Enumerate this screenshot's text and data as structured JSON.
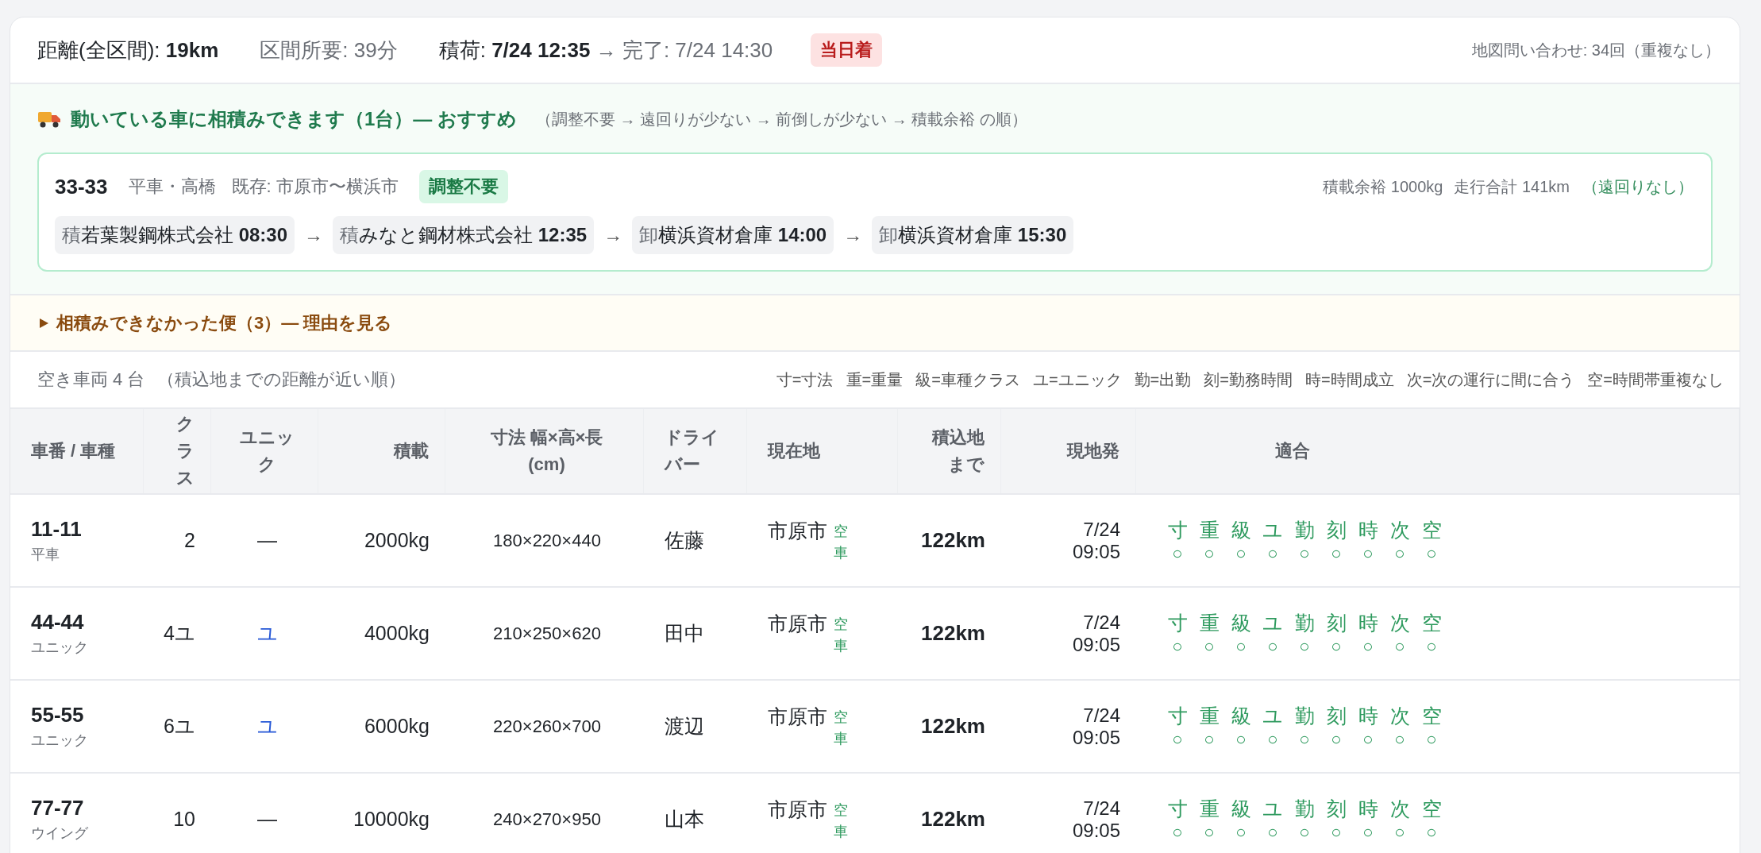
{
  "summary": {
    "distance_label": "距離(全区間):",
    "distance_value": "19km",
    "duration": "区間所要: 39分",
    "loading_label": "積荷:",
    "loading_value": "7/24 12:35",
    "arrow": "→",
    "completion": "完了: 7/24 14:30",
    "badge": "当日着",
    "map_queries": "地図問い合わせ: 34回（重複なし）"
  },
  "recommendation": {
    "title": "動いている車に相積みできます（1台）— おすすめ",
    "note": "（調整不要 → 遠回りが少ない → 前倒しが少ない → 積載余裕 の順）",
    "card": {
      "vehicle": "33-33",
      "type": "平車・高橋",
      "existing": "既存: 市原市〜横浜市",
      "badge": "調整不要",
      "capacity": "積載余裕 1000kg",
      "total": "走行合計 141km",
      "detour": "（遠回りなし）",
      "arrow": "→",
      "stops": [
        {
          "type": "積",
          "place": "若葉製鋼株式会社",
          "time": "08:30"
        },
        {
          "type": "積",
          "place": "みなと鋼材株式会社",
          "time": "12:35"
        },
        {
          "type": "卸",
          "place": "横浜資材倉庫",
          "time": "14:00"
        },
        {
          "type": "卸",
          "place": "横浜資材倉庫",
          "time": "15:30"
        }
      ]
    }
  },
  "rejected": {
    "label": "相積みできなかった便（3）— 理由を見る",
    "expanded": false
  },
  "vehicles": {
    "count": "空き車両 4 台",
    "sort_note": "（積込地までの距離が近い順）",
    "legend": [
      "寸=寸法",
      "重=重量",
      "級=車種クラス",
      "ユ=ユニック",
      "勤=出勤",
      "刻=勤務時間",
      "時=時間成立",
      "次=次の運行に間に合う",
      "空=時間帯重複なし"
    ]
  },
  "table": {
    "columns": [
      "車番 / 車種",
      "クラス",
      "ユニック",
      "積載",
      "寸法 幅×高×長 (cm)",
      "ドライバー",
      "現在地",
      "積込地まで",
      "現地発",
      "適合"
    ],
    "rows": [
      {
        "number": "11-11",
        "type": "平車",
        "class": "2",
        "unic": "—",
        "unic_available": false,
        "load": "2000kg",
        "size": "180×220×440",
        "driver": "佐藤",
        "location": "市原市",
        "status": "空車",
        "distance": "122km",
        "date": "7/24",
        "time": "09:05",
        "fit": [
          {
            "label": "寸",
            "mark": "○"
          },
          {
            "label": "重",
            "mark": "○"
          },
          {
            "label": "級",
            "mark": "○"
          },
          {
            "label": "ユ",
            "mark": "○"
          },
          {
            "label": "勤",
            "mark": "○"
          },
          {
            "label": "刻",
            "mark": "○"
          },
          {
            "label": "時",
            "mark": "○"
          },
          {
            "label": "次",
            "mark": "○"
          },
          {
            "label": "空",
            "mark": "○"
          }
        ]
      },
      {
        "number": "44-44",
        "type": "ユニック",
        "class": "4ユ",
        "unic": "ユ",
        "unic_available": true,
        "load": "4000kg",
        "size": "210×250×620",
        "driver": "田中",
        "location": "市原市",
        "status": "空車",
        "distance": "122km",
        "date": "7/24",
        "time": "09:05",
        "fit": [
          {
            "label": "寸",
            "mark": "○"
          },
          {
            "label": "重",
            "mark": "○"
          },
          {
            "label": "級",
            "mark": "○"
          },
          {
            "label": "ユ",
            "mark": "○"
          },
          {
            "label": "勤",
            "mark": "○"
          },
          {
            "label": "刻",
            "mark": "○"
          },
          {
            "label": "時",
            "mark": "○"
          },
          {
            "label": "次",
            "mark": "○"
          },
          {
            "label": "空",
            "mark": "○"
          }
        ]
      },
      {
        "number": "55-55",
        "type": "ユニック",
        "class": "6ユ",
        "unic": "ユ",
        "unic_available": true,
        "load": "6000kg",
        "size": "220×260×700",
        "driver": "渡辺",
        "location": "市原市",
        "status": "空車",
        "distance": "122km",
        "date": "7/24",
        "time": "09:05",
        "fit": [
          {
            "label": "寸",
            "mark": "○"
          },
          {
            "label": "重",
            "mark": "○"
          },
          {
            "label": "級",
            "mark": "○"
          },
          {
            "label": "ユ",
            "mark": "○"
          },
          {
            "label": "勤",
            "mark": "○"
          },
          {
            "label": "刻",
            "mark": "○"
          },
          {
            "label": "時",
            "mark": "○"
          },
          {
            "label": "次",
            "mark": "○"
          },
          {
            "label": "空",
            "mark": "○"
          }
        ]
      },
      {
        "number": "77-77",
        "type": "ウイング",
        "class": "10",
        "unic": "—",
        "unic_available": false,
        "load": "10000kg",
        "size": "240×270×950",
        "driver": "山本",
        "location": "市原市",
        "status": "空車",
        "distance": "122km",
        "date": "7/24",
        "time": "09:05",
        "fit": [
          {
            "label": "寸",
            "mark": "○"
          },
          {
            "label": "重",
            "mark": "○"
          },
          {
            "label": "級",
            "mark": "○"
          },
          {
            "label": "ユ",
            "mark": "○"
          },
          {
            "label": "勤",
            "mark": "○"
          },
          {
            "label": "刻",
            "mark": "○"
          },
          {
            "label": "時",
            "mark": "○"
          },
          {
            "label": "次",
            "mark": "○"
          },
          {
            "label": "空",
            "mark": "○"
          }
        ]
      }
    ]
  }
}
